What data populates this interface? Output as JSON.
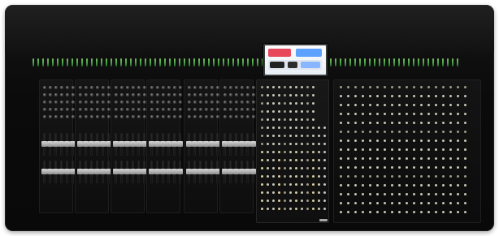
{
  "image": {
    "subject": "",
    "label": ""
  },
  "palette": {
    "body": "#0b0b0b",
    "panel": "#141414",
    "screen": "#eef3fa",
    "accent_red": "#e7465b",
    "accent_blue": "#5da2ff",
    "meter": "#67c65b"
  }
}
